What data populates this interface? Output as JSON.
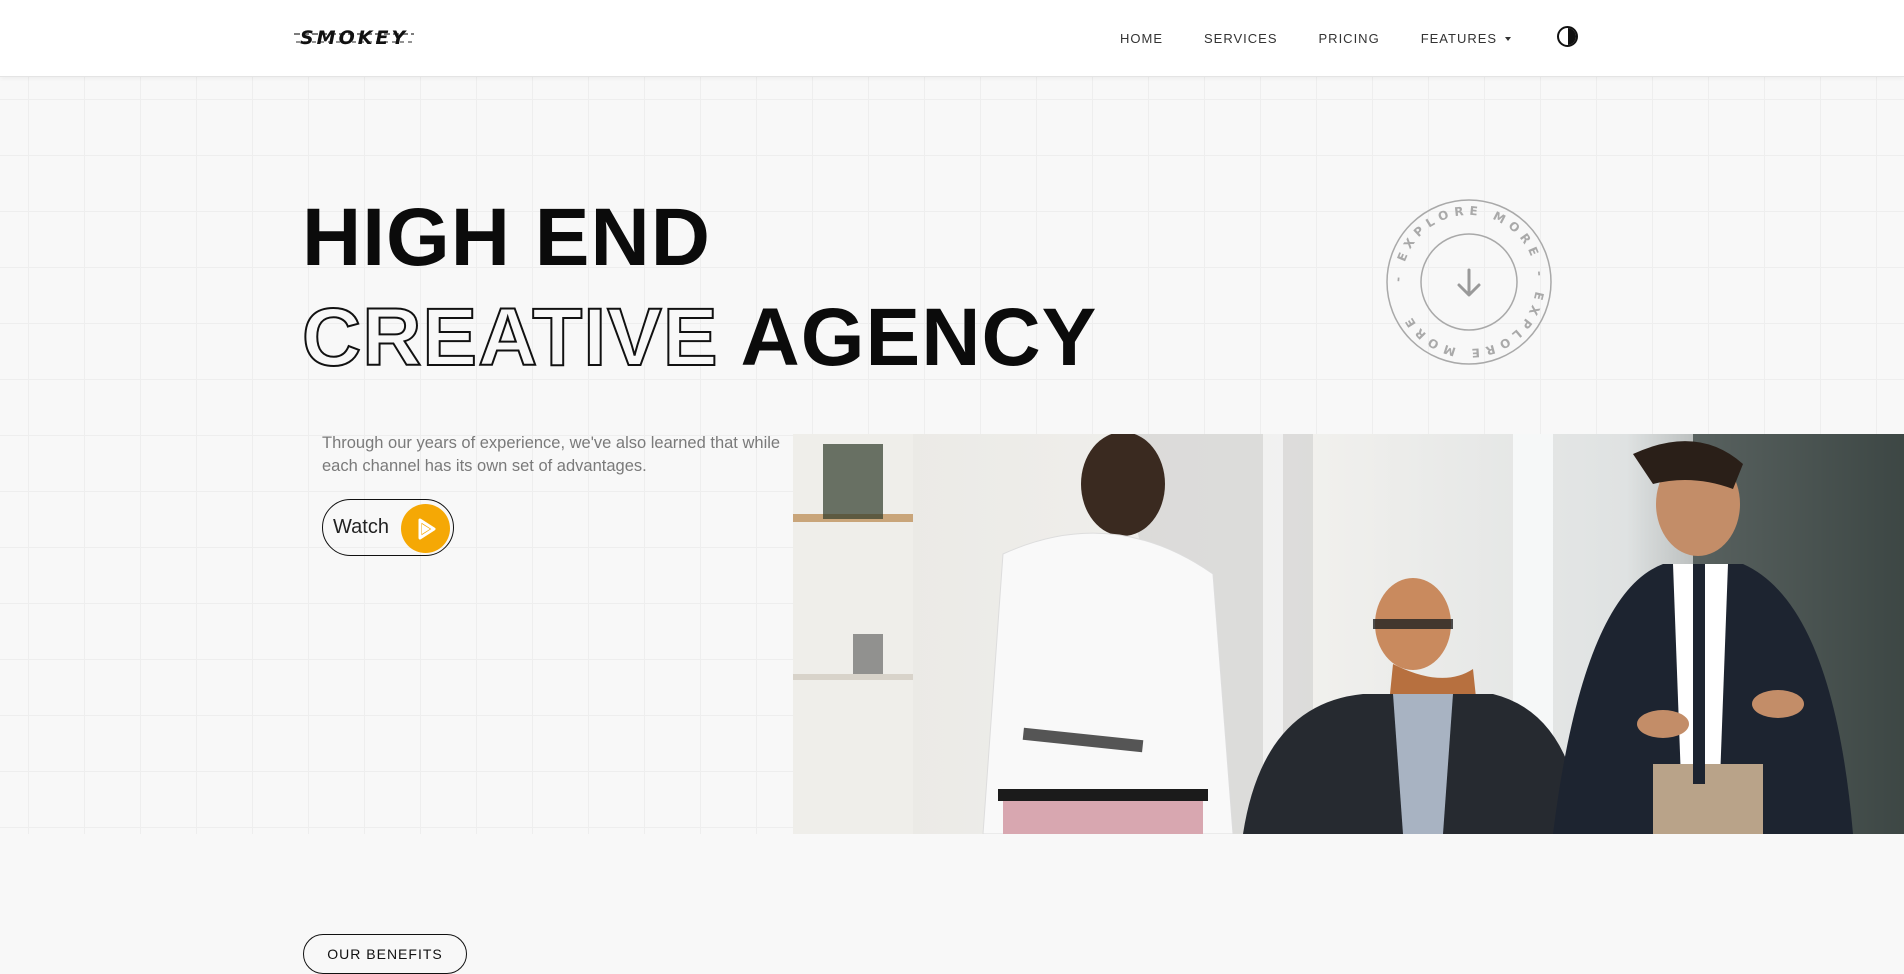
{
  "header": {
    "logo": "SMOKEY",
    "nav": [
      {
        "label": "HOME"
      },
      {
        "label": "SERVICES"
      },
      {
        "label": "PRICING"
      },
      {
        "label": "FEATURES"
      }
    ],
    "theme_toggle_icon": "contrast-icon"
  },
  "hero": {
    "line1": "HIGH END",
    "line2_outline": "CREATIVE",
    "line2_solid": "AGENCY",
    "explore_badge_text": "- EXPLORE MORE - EXPLORE MORE",
    "explore_badge_icon": "arrow-down-icon",
    "description": "Through our years of experience, we've also learned that while each channel has its own set of advantages.",
    "watch_label": "Watch",
    "watch_icon": "play-icon",
    "accent_color": "#f5a805"
  },
  "benefits": {
    "pill_label": "OUR BENEFITS"
  }
}
